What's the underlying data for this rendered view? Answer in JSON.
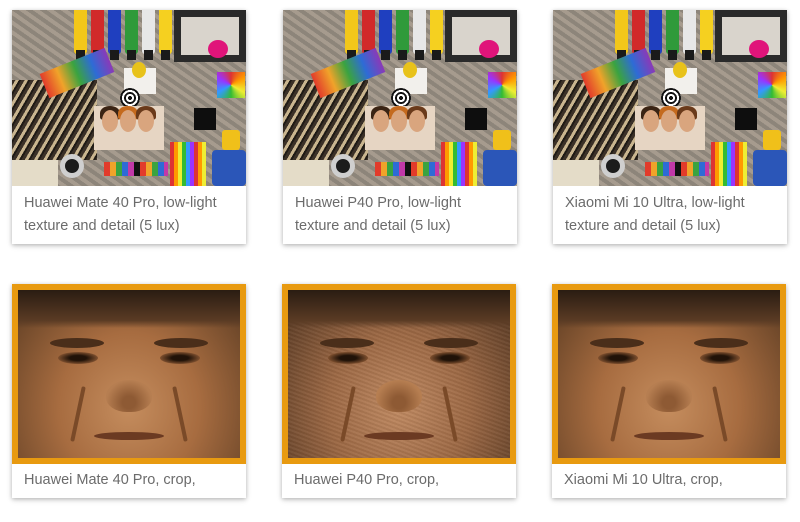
{
  "gallery": {
    "row1": [
      {
        "caption": "Huawei Mate 40 Pro, low-light texture and detail (5 lux)",
        "image": "art-supplies-collage"
      },
      {
        "caption": "Huawei P40 Pro, low-light texture and detail (5 lux)",
        "image": "art-supplies-collage"
      },
      {
        "caption": "Xiaomi Mi 10 Ultra, low-light texture and detail (5 lux)",
        "image": "art-supplies-collage"
      }
    ],
    "row2": [
      {
        "caption": "Huawei Mate 40 Pro, crop,",
        "image": "face-crop"
      },
      {
        "caption": "Huawei P40 Pro, crop,",
        "image": "face-crop"
      },
      {
        "caption": "Xiaomi Mi 10 Ultra, crop,",
        "image": "face-crop"
      }
    ],
    "colors": {
      "highlight_border": "#e89a10",
      "caption_text": "#6b6b6b",
      "background": "#ffffff"
    }
  }
}
